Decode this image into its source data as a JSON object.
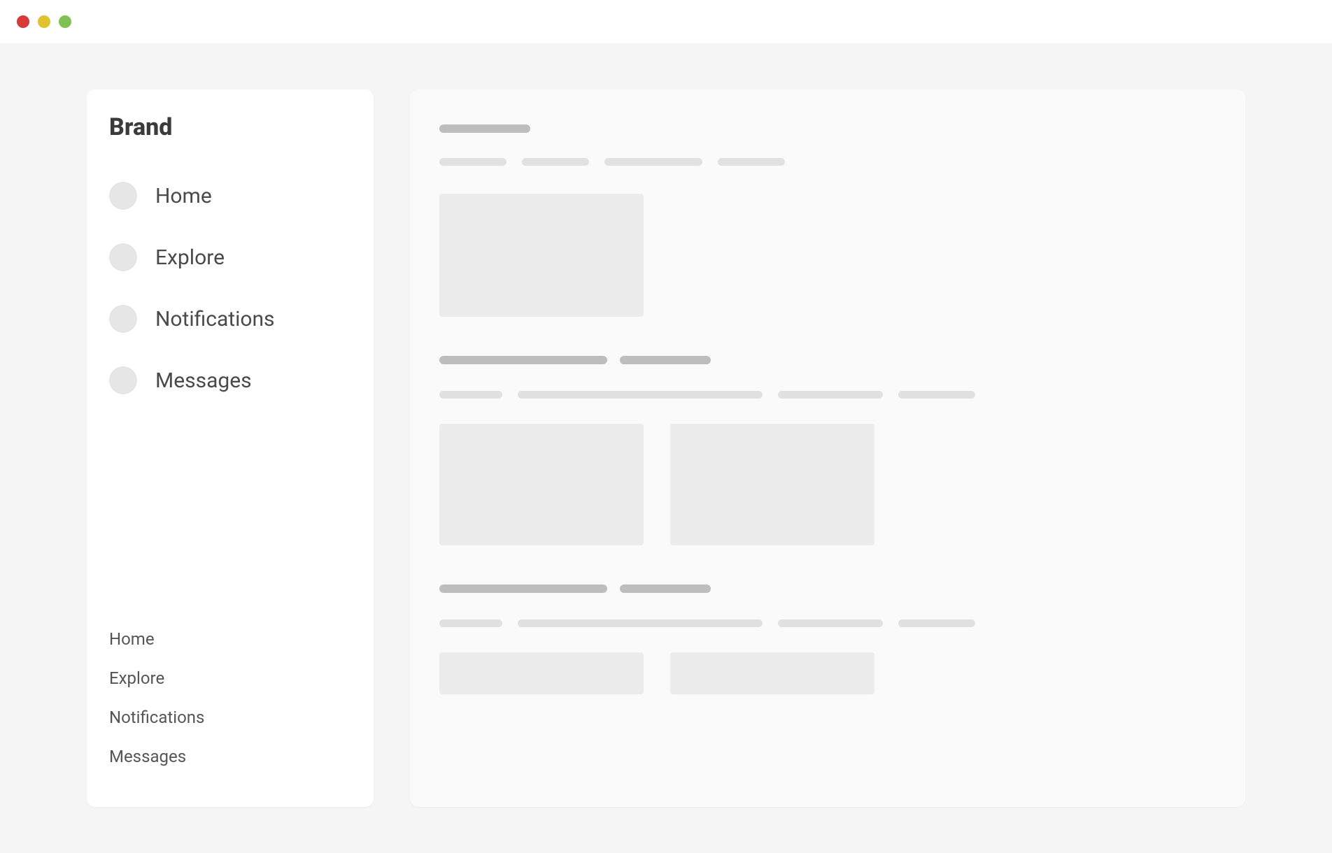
{
  "window": {
    "dots": [
      "red",
      "yellow",
      "green"
    ]
  },
  "sidebar": {
    "brand": "Brand",
    "primary": [
      {
        "label": "Home"
      },
      {
        "label": "Explore"
      },
      {
        "label": "Notifications"
      },
      {
        "label": "Messages"
      }
    ],
    "secondary": [
      {
        "label": "Home"
      },
      {
        "label": "Explore"
      },
      {
        "label": "Notifications"
      },
      {
        "label": "Messages"
      }
    ]
  }
}
